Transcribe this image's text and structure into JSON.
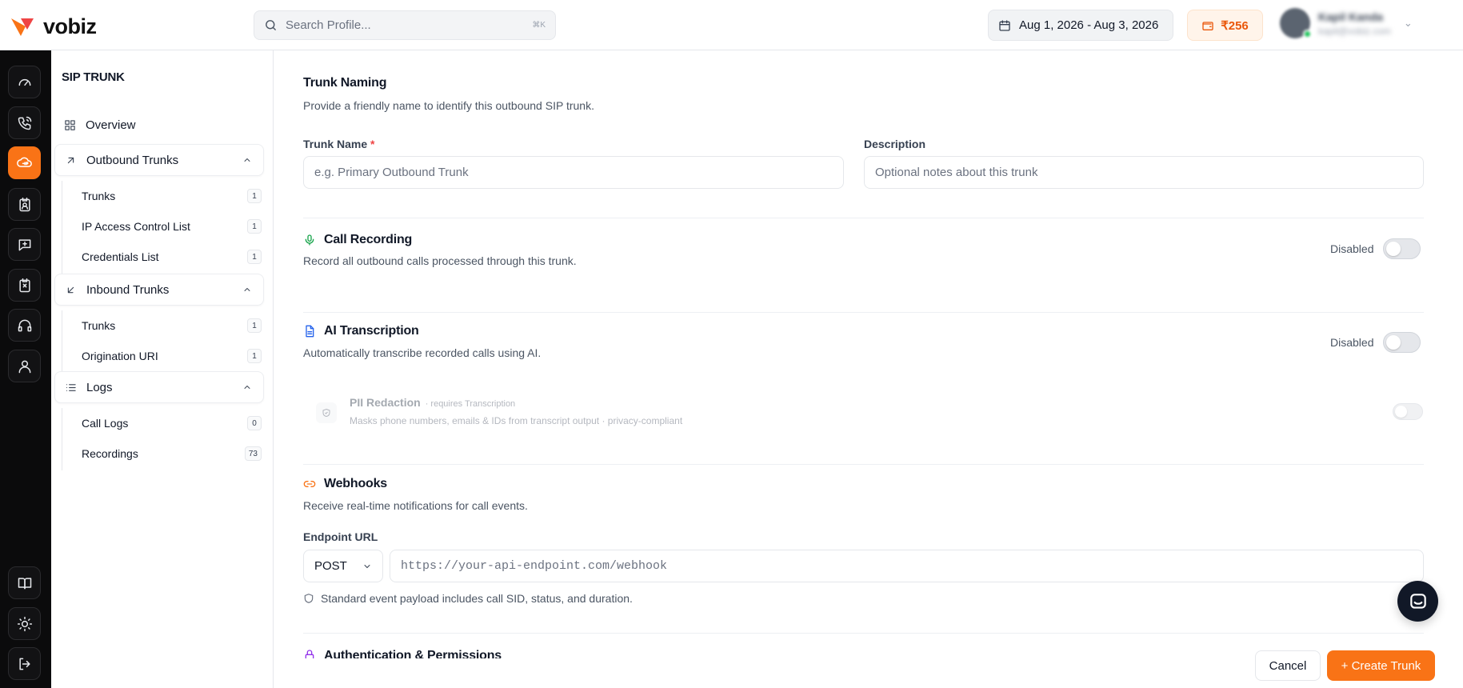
{
  "brand": {
    "name": "vobiz",
    "accent": "#f97316"
  },
  "search": {
    "placeholder": "Search Profile...",
    "shortcut": "⌘K"
  },
  "header": {
    "date_range": "Aug 1, 2026 - Aug 3, 2026",
    "balance": "₹256",
    "user": {
      "name": "Kapil Kanda",
      "email": "kapil@vobiz.com"
    }
  },
  "rail": {
    "top_icons": [
      "gauge-icon",
      "phone-call-icon",
      "sip-icon",
      "contact-badge-icon",
      "message-plus-icon",
      "report-icon",
      "headset-icon",
      "user-icon"
    ],
    "active": "sip-icon",
    "bottom_icons": [
      "book-icon",
      "sun-icon",
      "logout-icon"
    ]
  },
  "sidebar": {
    "title": "SIP TRUNK",
    "overview": "Overview",
    "groups": [
      {
        "label": "Outbound Trunks",
        "items": [
          {
            "label": "Trunks",
            "count": "1"
          },
          {
            "label": "IP Access Control List",
            "count": "1"
          },
          {
            "label": "Credentials List",
            "count": "1"
          }
        ]
      },
      {
        "label": "Inbound Trunks",
        "items": [
          {
            "label": "Trunks",
            "count": "1"
          },
          {
            "label": "Origination URI",
            "count": "1"
          }
        ]
      },
      {
        "label": "Logs",
        "items": [
          {
            "label": "Call Logs",
            "count": "0"
          },
          {
            "label": "Recordings",
            "count": "73"
          }
        ]
      }
    ]
  },
  "form": {
    "naming": {
      "title": "Trunk Naming",
      "subtitle": "Provide a friendly name to identify this outbound SIP trunk.",
      "name_label": "Trunk Name",
      "required_mark": "*",
      "name_placeholder": "e.g. Primary Outbound Trunk",
      "desc_label": "Description",
      "desc_placeholder": "Optional notes about this trunk"
    },
    "recording": {
      "title": "Call Recording",
      "subtitle": "Record all outbound calls processed through this trunk.",
      "state": "Disabled"
    },
    "transcription": {
      "title": "AI Transcription",
      "subtitle": "Automatically transcribe recorded calls using AI.",
      "state": "Disabled",
      "pii": {
        "title": "PII Redaction",
        "requires": "· requires Transcription",
        "desc": "Masks phone numbers, emails & IDs from transcript output · privacy-compliant"
      }
    },
    "webhooks": {
      "title": "Webhooks",
      "subtitle": "Receive real-time notifications for call events.",
      "endpoint_label": "Endpoint URL",
      "method": "POST",
      "url_placeholder": "https://your-api-endpoint.com/webhook",
      "note": "Standard event payload includes call SID, status, and duration."
    },
    "auth": {
      "title": "Authentication & Permissions"
    }
  },
  "actions": {
    "cancel": "Cancel",
    "create": "+ Create Trunk"
  }
}
